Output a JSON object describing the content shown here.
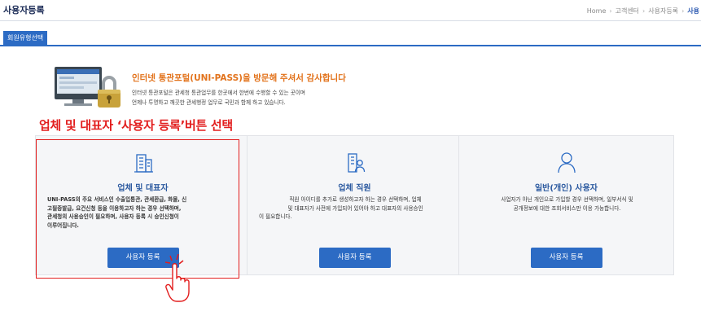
{
  "header": {
    "title": "사용자등록",
    "breadcrumb": [
      "Home",
      "고객센터",
      "사용자등록",
      "사용"
    ]
  },
  "tabs": [
    {
      "label": "회원유형선택"
    }
  ],
  "intro": {
    "welcome": "인터넷 통관포털(UNI-PASS)을 방문해 주셔서 감사합니다",
    "line1": "인터넷 통관포털은 관세청 통관업무를 한곳에서 한번에 수행할 수 있는 곳이며",
    "line2": "언제나 투명하고 깨끗한 관세행정 업무로 국민과 함께 하고 있습니다."
  },
  "instruction": "업체 및 대표자 ‘사용자 등록’버튼 선택",
  "cards": [
    {
      "icon": "building-icon",
      "title": "업체 및 대표자",
      "desc_lines": [
        "UNI-PASS의 주요 서비스인 수출입통관, 관세환급, 화물, 신",
        "고필증발급, 요건신청 등을 이용하고자 하는 경우 선택하며,",
        "관세청의 사용승인이 필요하며, 사용자 등록 시 승인신청이",
        "이루어집니다."
      ],
      "button": "사용자 등록"
    },
    {
      "icon": "employee-icon",
      "title": "업체 직원",
      "desc_lines": [
        "직원 아이디를 추가로 생성하고자 하는 경우 선택하며, 업체",
        "및 대표자가 사전에 가입되어 있어야 하고 대표자의 사용승인",
        "이 필요합니다."
      ],
      "button": "사용자 등록"
    },
    {
      "icon": "person-icon",
      "title": "일반(개인) 사용자",
      "desc_lines": [
        "사업자가 아닌 개인으로 가입할 경우 선택하며, 일부서식 및",
        "공개정보에 대한 조회서비스만 이용 가능합니다."
      ],
      "button": "사용자 등록"
    }
  ],
  "colors": {
    "accent": "#2c6bc4",
    "highlight": "#e21d1d",
    "welcome": "#e2721b"
  }
}
